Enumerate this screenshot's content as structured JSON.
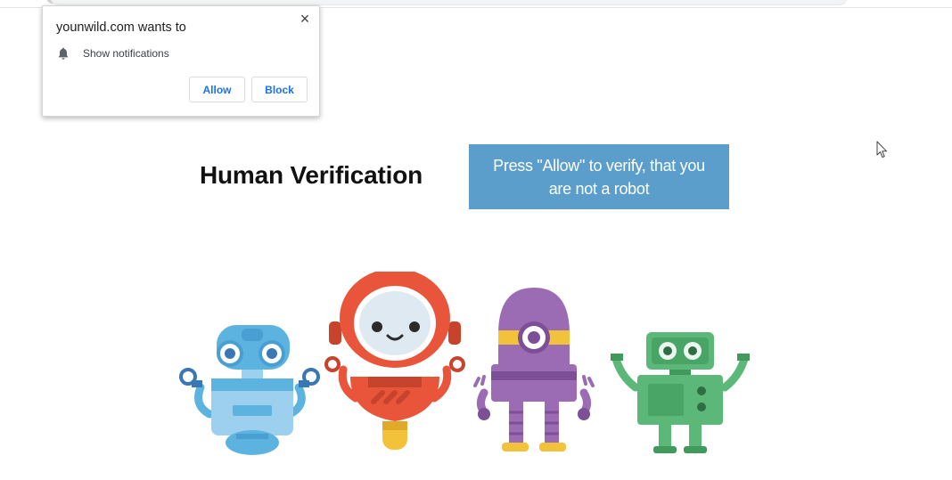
{
  "popup": {
    "title": "younwild.com wants to",
    "close_glyph": "×",
    "permission_icon": "bell-icon",
    "permission_label": "Show notifications",
    "allow_label": "Allow",
    "block_label": "Block"
  },
  "main": {
    "heading": "Human Verification",
    "verify_message": "Press \"Allow\" to verify, that you are not a robot"
  },
  "illustration": {
    "name": "robots-illustration",
    "robots": [
      "blue-robot",
      "red-robot",
      "purple-robot",
      "green-robot"
    ]
  },
  "colors": {
    "accent_blue_box": "#5b9ecb",
    "button_text": "#1a73e8",
    "robot_blue": "#5db3e0",
    "robot_red": "#e8553b",
    "robot_purple": "#9b6bb3",
    "robot_green": "#5cb878"
  }
}
